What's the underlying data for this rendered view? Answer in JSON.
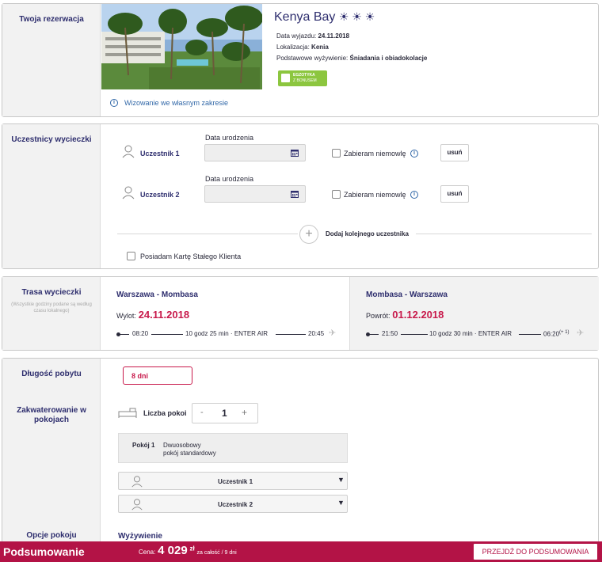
{
  "reservation": {
    "side_title": "Twoja rezerwacja",
    "hotel_name": "Kenya Bay",
    "stars": "☀ ☀ ☀",
    "departure_label": "Data wyjazdu:",
    "departure_value": "24.11.2018",
    "location_label": "Lokalizacja:",
    "location_value": "Kenia",
    "board_label": "Podstawowe wyżywienie:",
    "board_value": "Śniadania i obiadokolacje",
    "badge_line1": "EGZOTYKA",
    "badge_line2": "Z BONUSEM",
    "visa_link": "Wizowanie we własnym zakresie"
  },
  "participants": {
    "side_title": "Uczestnicy wycieczki",
    "dob_label": "Data urodzenia",
    "infant_label": "Zabieram niemowlę",
    "remove_label": "usuń",
    "list": [
      {
        "name": "Uczestnik 1"
      },
      {
        "name": "Uczestnik 2"
      }
    ],
    "add_label": "Dodaj kolejnego uczestnika",
    "loyalty_label": "Posiadam Kartę Stałego Klienta"
  },
  "route": {
    "side_title": "Trasa wycieczki",
    "side_note": "(Wszystkie godziny podane są według czasu lokalnego)",
    "outbound": {
      "title": "Warszawa - Mombasa",
      "date_label": "Wylot:",
      "date": "24.11.2018",
      "dep_time": "08:20",
      "duration": "10 godz 25 min · ENTER AIR",
      "arr_time": "20:45",
      "arr_suffix": ""
    },
    "inbound": {
      "title": "Mombasa - Warszawa",
      "date_label": "Powrót:",
      "date": "01.12.2018",
      "dep_time": "21:50",
      "duration": "10 godz 30 min · ENTER AIR",
      "arr_time": "06:20",
      "arr_suffix": "(+ 1)"
    }
  },
  "stay": {
    "length_title": "Długość pobytu",
    "length_value": "8 dni",
    "rooms_title_1": "Zakwaterowanie w",
    "rooms_title_2": "pokojach",
    "rooms_count_label": "Liczba pokoi",
    "rooms_count": "1",
    "minus": "-",
    "plus": "+",
    "room_name": "Pokój 1",
    "room_type_1": "Dwuosobowy",
    "room_type_2": "pokój standardowy",
    "room_people": [
      "Uczestnik 1",
      "Uczestnik 2"
    ],
    "options_title": "Opcje pokoju",
    "options_value": "Wyżywienie"
  },
  "footer": {
    "title": "Podsumowanie",
    "price_label": "Cena:",
    "price_value": "4 029",
    "currency": "zł",
    "price_note": "za całość / 9 dni",
    "cta": "PRZEJDŹ DO PODSUMOWANIA"
  },
  "colors": {
    "accent": "#c8194b",
    "footer": "#b31346",
    "navy": "#2e2e6e",
    "badge": "#8cc63f",
    "link": "#3268a8"
  }
}
